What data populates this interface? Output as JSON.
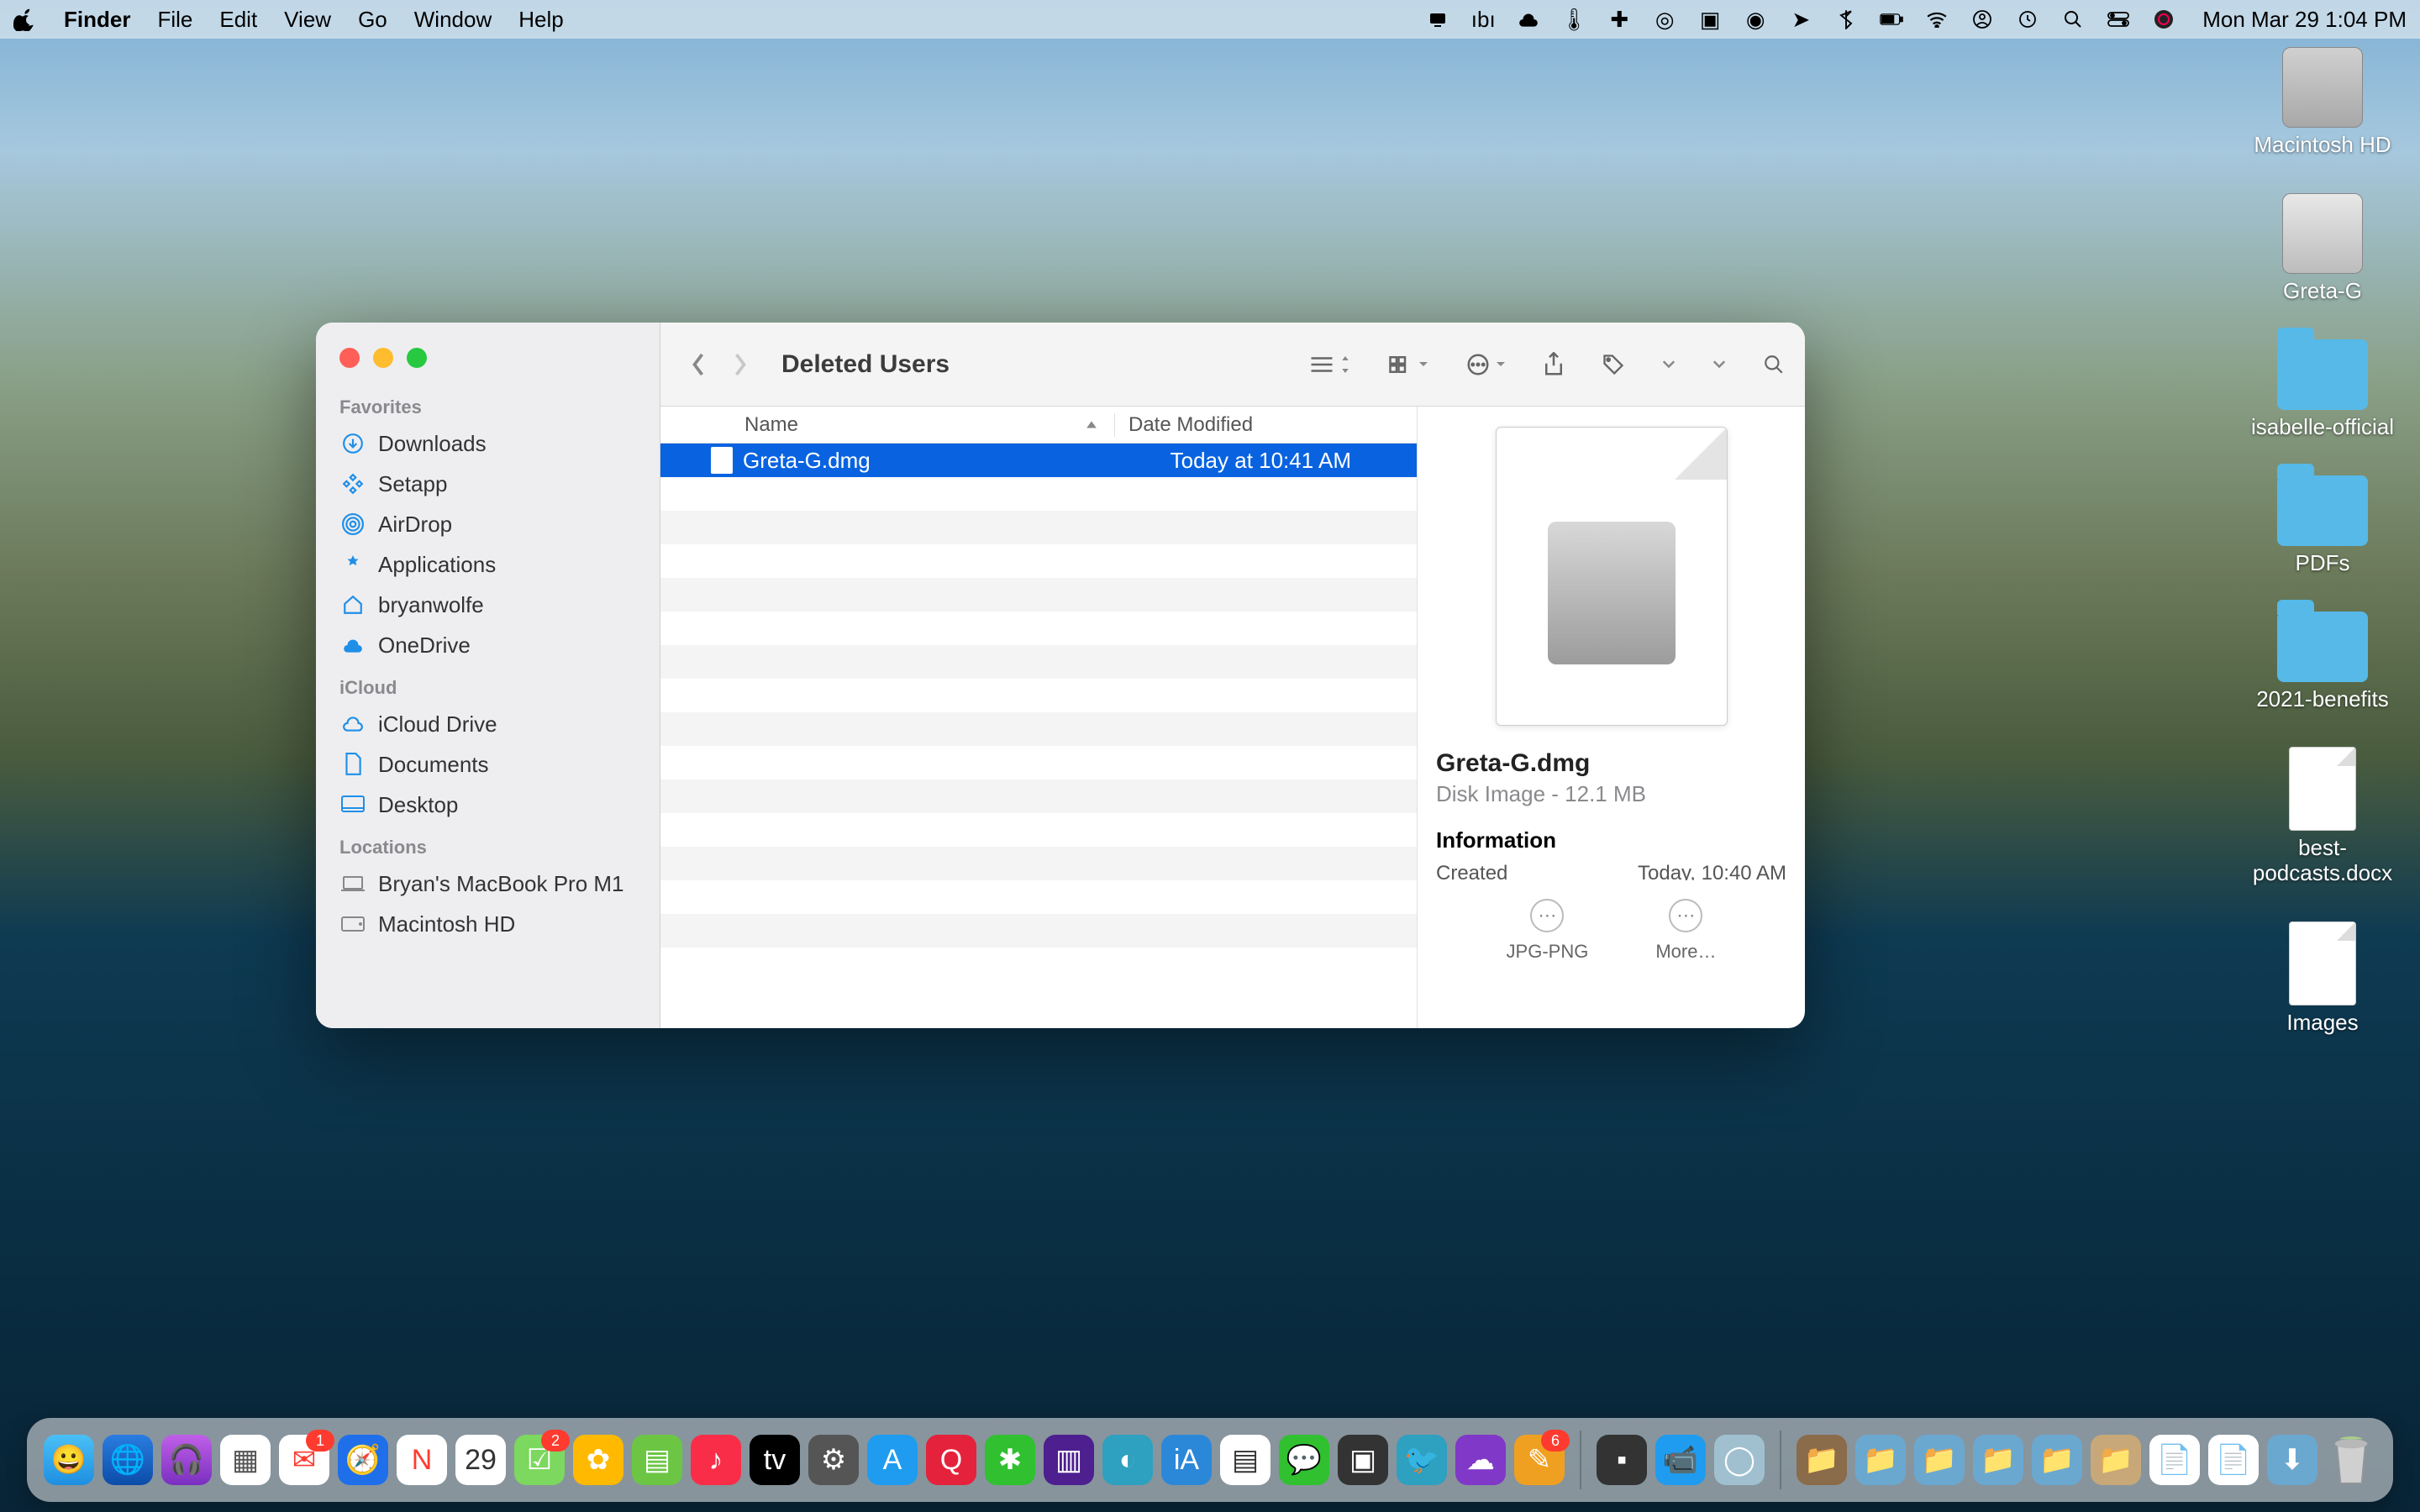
{
  "menubar": {
    "app": "Finder",
    "items": [
      "File",
      "Edit",
      "View",
      "Go",
      "Window",
      "Help"
    ],
    "clock": "Mon Mar 29  1:04 PM"
  },
  "desktop": {
    "items": [
      {
        "label": "Macintosh HD",
        "type": "drive"
      },
      {
        "label": "Greta-G",
        "type": "drive-ext"
      },
      {
        "label": "isabelle-official",
        "type": "folder"
      },
      {
        "label": "PDFs",
        "type": "folder"
      },
      {
        "label": "2021-benefits",
        "type": "folder"
      },
      {
        "label": "best-podcasts.docx",
        "type": "doc"
      },
      {
        "label": "Images",
        "type": "doc"
      }
    ]
  },
  "finder": {
    "title": "Deleted Users",
    "sidebar": {
      "sections": [
        {
          "header": "Favorites",
          "items": [
            "Downloads",
            "Setapp",
            "AirDrop",
            "Applications",
            "bryanwolfe",
            "OneDrive"
          ]
        },
        {
          "header": "iCloud",
          "items": [
            "iCloud Drive",
            "Documents",
            "Desktop"
          ]
        },
        {
          "header": "Locations",
          "items": [
            "Bryan's MacBook Pro M1",
            "Macintosh HD"
          ]
        }
      ]
    },
    "columns": {
      "name": "Name",
      "date": "Date Modified"
    },
    "rows": [
      {
        "name": "Greta-G.dmg",
        "date": "Today at 10:41 AM",
        "selected": true
      }
    ],
    "preview": {
      "title": "Greta-G.dmg",
      "subtitle": "Disk Image - 12.1 MB",
      "info_header": "Information",
      "created_label": "Created",
      "created_value": "Today, 10:40 AM",
      "actions": [
        "JPG-PNG",
        "More…"
      ]
    }
  },
  "dock": {
    "badges": {
      "mail": "1",
      "cal_day": "29",
      "reminders": "2",
      "notes": "6"
    }
  }
}
